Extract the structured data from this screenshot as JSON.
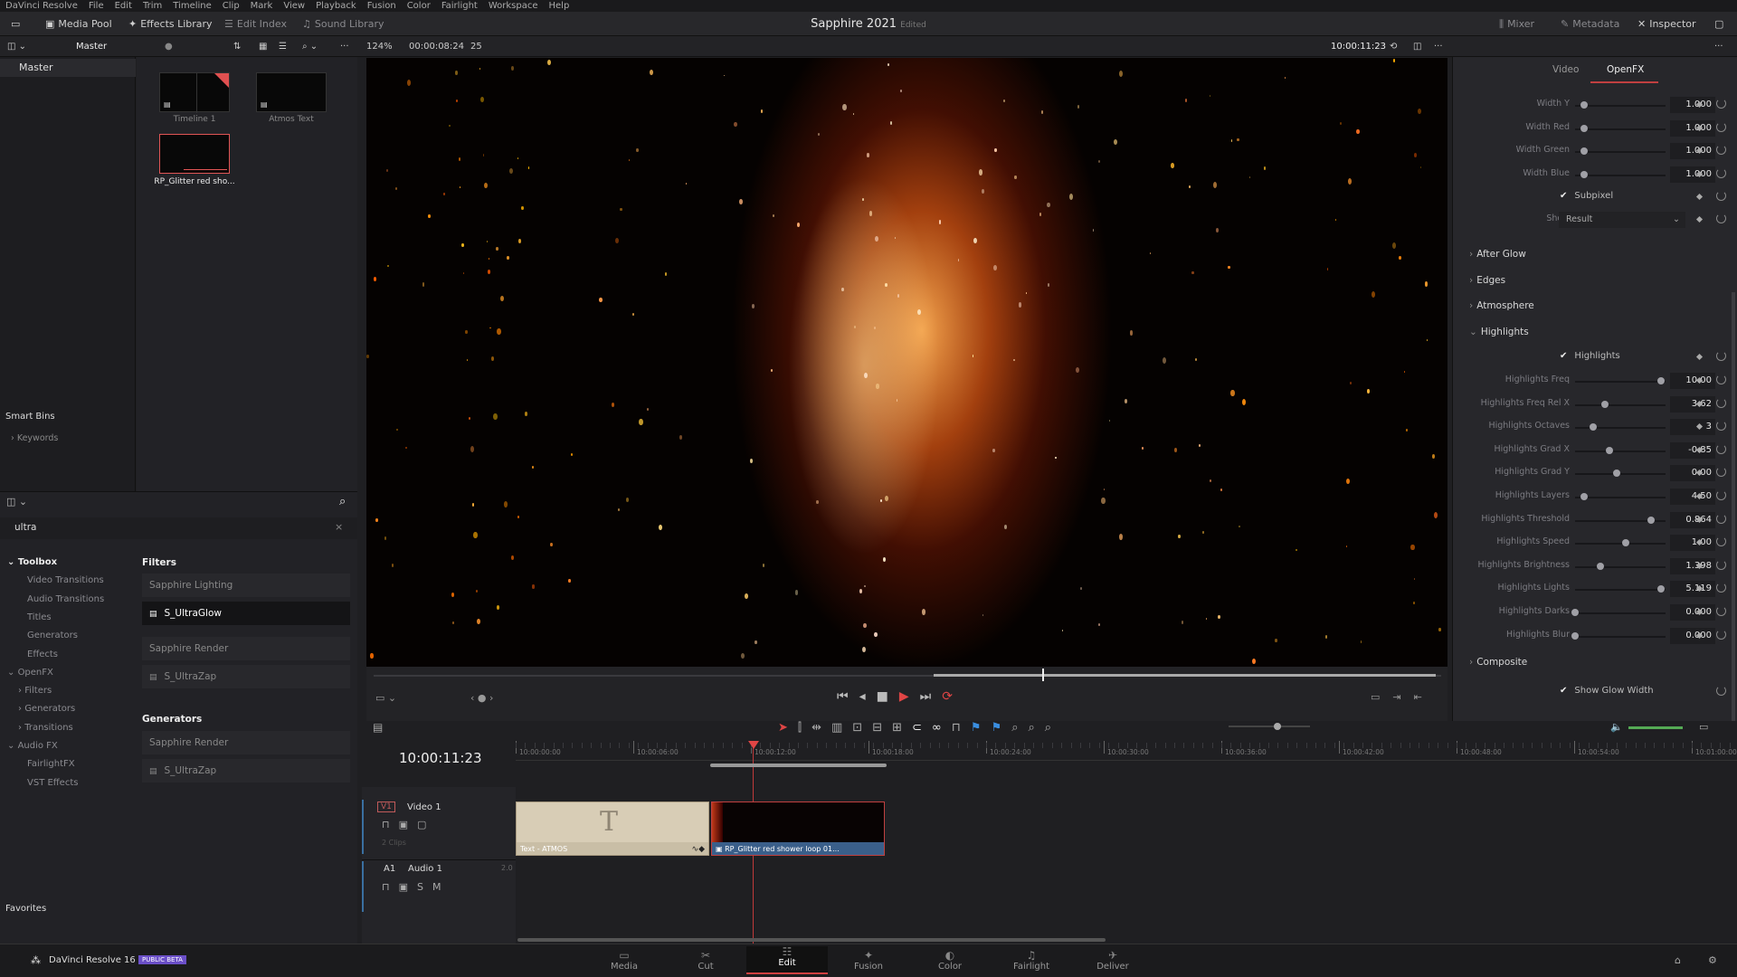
{
  "menubar": [
    "DaVinci Resolve",
    "File",
    "Edit",
    "Trim",
    "Timeline",
    "Clip",
    "Mark",
    "View",
    "Playback",
    "Fusion",
    "Color",
    "Fairlight",
    "Workspace",
    "Help"
  ],
  "toolbar": {
    "media_pool": "Media Pool",
    "effects_library": "Effects Library",
    "edit_index": "Edit Index",
    "sound_library": "Sound Library",
    "project_title": "Sapphire 2021",
    "project_status": "Edited",
    "mixer": "Mixer",
    "metadata": "Metadata",
    "inspector": "Inspector"
  },
  "subbar": {
    "bin": "Master",
    "zoom": "124%",
    "duration": "00:00:08:24",
    "fps": "25",
    "timecode": "10:00:11:23"
  },
  "bins": {
    "master": "Master",
    "smart_bins": "Smart Bins",
    "keywords": "Keywords",
    "favorites": "Favorites"
  },
  "clips": [
    {
      "name": "Timeline 1"
    },
    {
      "name": "Atmos Text"
    },
    {
      "name": "RP_Glitter red sho..."
    }
  ],
  "effects": {
    "search_value": "ultra",
    "tree": [
      {
        "label": "Toolbox",
        "level": 0,
        "expanded": true,
        "bold": true
      },
      {
        "label": "Video Transitions",
        "level": 1
      },
      {
        "label": "Audio Transitions",
        "level": 1
      },
      {
        "label": "Titles",
        "level": 1
      },
      {
        "label": "Generators",
        "level": 1
      },
      {
        "label": "Effects",
        "level": 1
      },
      {
        "label": "OpenFX",
        "level": 0,
        "expanded": true
      },
      {
        "label": "Filters",
        "level": 1,
        "collapsed": true
      },
      {
        "label": "Generators",
        "level": 1,
        "collapsed": true
      },
      {
        "label": "Transitions",
        "level": 1,
        "collapsed": true
      },
      {
        "label": "Audio FX",
        "level": 0,
        "expanded": true
      },
      {
        "label": "FairlightFX",
        "level": 1
      },
      {
        "label": "VST Effects",
        "level": 1
      }
    ],
    "filters_heading": "Filters",
    "filters": [
      {
        "group": "Sapphire Lighting",
        "item": "S_UltraGlow",
        "selected": true
      },
      {
        "group": "Sapphire Render",
        "item": "S_UltraZap"
      }
    ],
    "generators_heading": "Generators",
    "generators": [
      {
        "group": "Sapphire Render",
        "item": "S_UltraZap"
      }
    ]
  },
  "inspector": {
    "tabs": [
      "Video",
      "OpenFX"
    ],
    "active_tab": "OpenFX",
    "width_params": [
      {
        "label": "Width Y",
        "value": "1.000",
        "level": 0.1
      },
      {
        "label": "Width Red",
        "value": "1.000",
        "level": 0.1
      },
      {
        "label": "Width Green",
        "value": "1.000",
        "level": 0.1
      },
      {
        "label": "Width Blue",
        "value": "1.000",
        "level": 0.1
      }
    ],
    "subpixel": "Subpixel",
    "show_label": "Show",
    "show_value": "Result",
    "sections": [
      "After Glow",
      "Edges",
      "Atmosphere",
      "Highlights"
    ],
    "highlights_toggle": "Highlights",
    "highlight_params": [
      {
        "label": "Highlights Freq",
        "value": "10.00",
        "level": 0.95
      },
      {
        "label": "Highlights Freq Rel X",
        "value": "3.62",
        "level": 0.33
      },
      {
        "label": "Highlights Octaves",
        "value": "3",
        "level": 0.2
      },
      {
        "label": "Highlights Grad X",
        "value": "-0.85",
        "level": 0.38
      },
      {
        "label": "Highlights Grad Y",
        "value": "0.00",
        "level": 0.46
      },
      {
        "label": "Highlights Layers",
        "value": "4.50",
        "level": 0.1
      },
      {
        "label": "Highlights Threshold",
        "value": "0.864",
        "level": 0.84
      },
      {
        "label": "Highlights Speed",
        "value": "1.00",
        "level": 0.56
      },
      {
        "label": "Highlights Brightness",
        "value": "1.398",
        "level": 0.28
      },
      {
        "label": "Highlights Lights",
        "value": "5.119",
        "level": 0.95
      },
      {
        "label": "Highlights Darks",
        "value": "0.000",
        "level": 0.0
      },
      {
        "label": "Highlights Blur",
        "value": "0.000",
        "level": 0.0
      }
    ],
    "composite": "Composite",
    "show_glow_width": "Show Glow Width"
  },
  "timeline": {
    "timecode": "10:00:11:23",
    "ruler": [
      "10:00:00:00",
      "10:00:06:00",
      "10:00:12:00",
      "10:00:18:00",
      "10:00:24:00",
      "10:00:30:00",
      "10:00:36:00",
      "10:00:42:00",
      "10:00:48:00",
      "10:00:54:00",
      "10:01:00:00"
    ],
    "video_track": {
      "id": "V1",
      "name": "Video 1",
      "clips_count": "2 Clips"
    },
    "audio_track": {
      "id": "A1",
      "name": "Audio 1",
      "channels": "2.0"
    },
    "clips": [
      {
        "name": "Text - ATMOS"
      },
      {
        "name": "RP_Glitter red shower loop 01..."
      }
    ]
  },
  "bottombar": {
    "app": "DaVinci Resolve 16",
    "badge": "PUBLIC BETA",
    "pages": [
      "Media",
      "Cut",
      "Edit",
      "Fusion",
      "Color",
      "Fairlight",
      "Deliver"
    ],
    "active_page": "Edit"
  },
  "colors": {
    "accent": "#d04040",
    "badge": "#6b4fc8",
    "clip_text": "#d8cdb6",
    "clip_video": "#3a5f8a"
  }
}
